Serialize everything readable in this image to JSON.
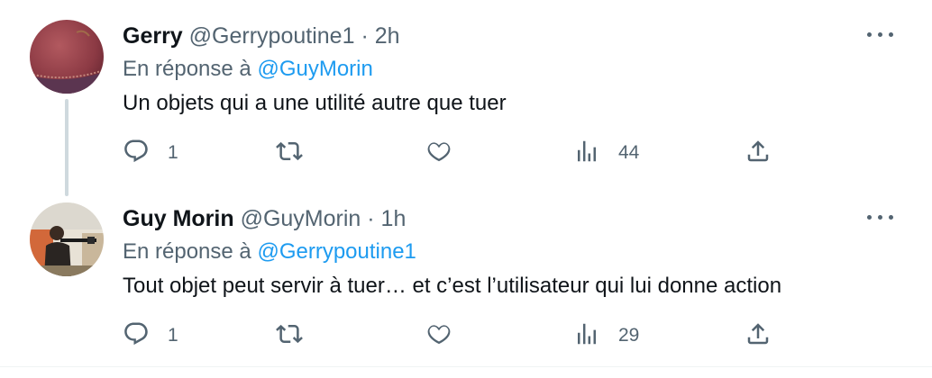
{
  "tweets": [
    {
      "name": "Gerry",
      "handle": "@Gerrypoutine1",
      "separator": "·",
      "time": "2h",
      "reply_prefix": "En réponse à",
      "reply_to": "@GuyMorin",
      "text": "Un objets qui a une utilité autre que tuer",
      "replies": "1",
      "retweets": "",
      "likes": "",
      "views": "44"
    },
    {
      "name": "Guy Morin",
      "handle": "@GuyMorin",
      "separator": "·",
      "time": "1h",
      "reply_prefix": "En réponse à",
      "reply_to": "@Gerrypoutine1",
      "text": "Tout objet peut servir à tuer… et c’est l’utilisateur qui lui donne action",
      "replies": "1",
      "retweets": "",
      "likes": "",
      "views": "29"
    }
  ],
  "colors": {
    "link": "#1d9bf0",
    "secondary": "#536471",
    "primary": "#0f1419",
    "thread_line": "#cfd9de"
  },
  "icons": [
    "reply-icon",
    "retweet-icon",
    "like-icon",
    "views-icon",
    "share-icon",
    "more-icon"
  ]
}
